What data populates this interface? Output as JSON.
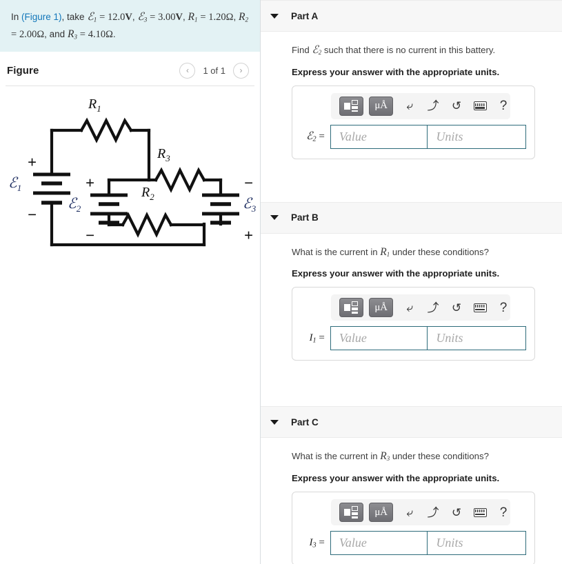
{
  "problem": {
    "prefix": "In ",
    "figure_link": "(Figure 1)",
    "middle": ", take ",
    "e1_sym": "ℰ",
    "e1_sub": "1",
    "e1_eq": "=",
    "e1_val": "12.0",
    "e1_unit": "V",
    "e3_sym": "ℰ",
    "e3_sub": "3",
    "e3_val": "3.00",
    "e3_unit": "V",
    "r1_sym": "R",
    "r1_sub": "1",
    "r1_val": "1.20",
    "r1_unit": "Ω",
    "r2_sym": "R",
    "r2_sub": "2",
    "r2_val": "2.00",
    "r2_unit": "Ω",
    "r3_sym": "R",
    "r3_sub": "3",
    "r3_val": "4.10",
    "r3_unit": "Ω",
    "conj": "and",
    "comma": ",",
    "period": "."
  },
  "figure": {
    "title": "Figure",
    "pager_label": "1 of 1",
    "prev_icon": "chevron-left-icon",
    "next_icon": "chevron-right-icon",
    "prev_glyph": "‹",
    "next_glyph": "›",
    "circuit": {
      "labels": {
        "R1": "R",
        "R1sub": "1",
        "R2": "R",
        "R2sub": "2",
        "R3": "R",
        "R3sub": "3",
        "E1": "ℰ",
        "E1sub": "1",
        "E2": "ℰ",
        "E2sub": "2",
        "E3": "ℰ",
        "E3sub": "3",
        "plus": "+",
        "minus": "−"
      }
    }
  },
  "toolbar": {
    "template_icon": "math-template-icon",
    "units_icon": "micro-angstrom-units-icon",
    "units_text": "μÅ",
    "undo_icon": "undo-arrow-icon",
    "undo_glyph": "⤶",
    "redo_icon": "redo-arrow-icon",
    "redo_glyph": "⤴",
    "reset_icon": "reset-circular-arrow-icon",
    "reset_glyph": "↺",
    "keyboard_icon": "keyboard-icon",
    "help_icon": "help-question-icon",
    "help_glyph": "?"
  },
  "parts": [
    {
      "id": "part-a",
      "title": "Part A",
      "question_pre": "Find ",
      "question_sym": "ℰ",
      "question_sub": "2",
      "question_post": " such that there is no current in this battery.",
      "instruction": "Express your answer with the appropriate units.",
      "answer_label_sym": "ℰ",
      "answer_label_sub": "2",
      "answer_label_eq": " =",
      "value_placeholder": "Value",
      "units_placeholder": "Units"
    },
    {
      "id": "part-b",
      "title": "Part B",
      "question_pre": "What is the current in ",
      "question_sym": "R",
      "question_sub": "1",
      "question_post": " under these conditions?",
      "instruction": "Express your answer with the appropriate units.",
      "answer_label_sym": "I",
      "answer_label_sub": "1",
      "answer_label_eq": " =",
      "value_placeholder": "Value",
      "units_placeholder": "Units"
    },
    {
      "id": "part-c",
      "title": "Part C",
      "question_pre": "What is the current in ",
      "question_sym": "R",
      "question_sub": "3",
      "question_post": " under these conditions?",
      "instruction": "Express your answer with the appropriate units.",
      "answer_label_sym": "I",
      "answer_label_sub": "3",
      "answer_label_eq": " =",
      "value_placeholder": "Value",
      "units_placeholder": "Units"
    }
  ],
  "colors": {
    "problem_box_bg": "#e3f2f4",
    "link": "#1277ba",
    "part_band_bg": "#f7f7f7",
    "input_border": "#2d6b7a",
    "placeholder": "#a8a8a8",
    "toolbar_bg": "#f4f4f4",
    "toolbar_button": "#6e6e73"
  }
}
